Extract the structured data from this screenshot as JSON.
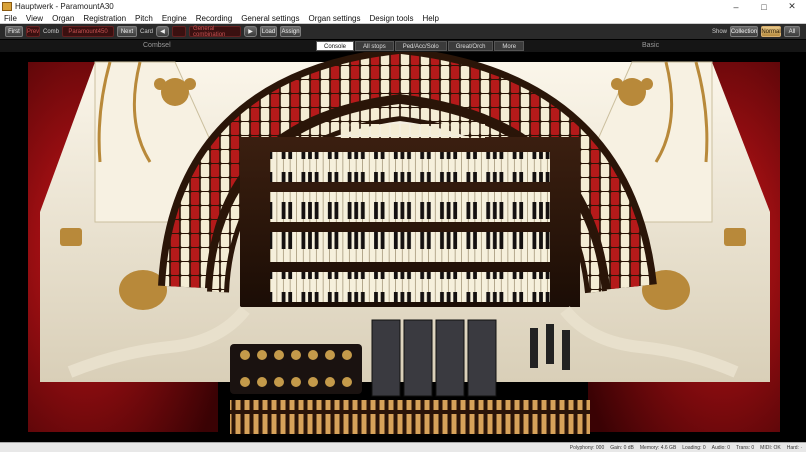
{
  "window": {
    "title": "Hauptwerk - ParamountA30",
    "close": "✕",
    "minimize": "–",
    "maximize": "□"
  },
  "menu": [
    "File",
    "View",
    "Organ",
    "Registration",
    "Pitch",
    "Engine",
    "Recording",
    "General settings",
    "Organ settings",
    "Design tools",
    "Help"
  ],
  "toolbar": {
    "first": "First",
    "combo_prev": "Prev",
    "combo_value": "Comb",
    "combo_text": "Paramount450",
    "next": "Next",
    "cmb_label": "Card",
    "cmb_value": "",
    "slot_text": "General combination",
    "load": "Load",
    "assign": "Assign",
    "show_label": "Show",
    "show_options": [
      "Collection",
      "Normal",
      "All"
    ],
    "show_selected": "Normal"
  },
  "panels": {
    "left_title": "Combsel",
    "right_title": "Basic",
    "tabs": [
      "Console",
      "All stops",
      "Ped/Acc/Solo",
      "Great/Orch",
      "More"
    ],
    "active_tab": "Console"
  },
  "colors": {
    "accent": "#d9b070",
    "curtain": "#a40d10",
    "console": "#f3ecdc",
    "gold": "#b58a3e"
  },
  "status": [
    "Polyphony: 000",
    "Gain: 0 dB",
    "Memory: 4.6 GB",
    "Loading: 0",
    "Audio: 0",
    "Trans: 0",
    "MIDI: OK",
    "Hard: ·"
  ]
}
